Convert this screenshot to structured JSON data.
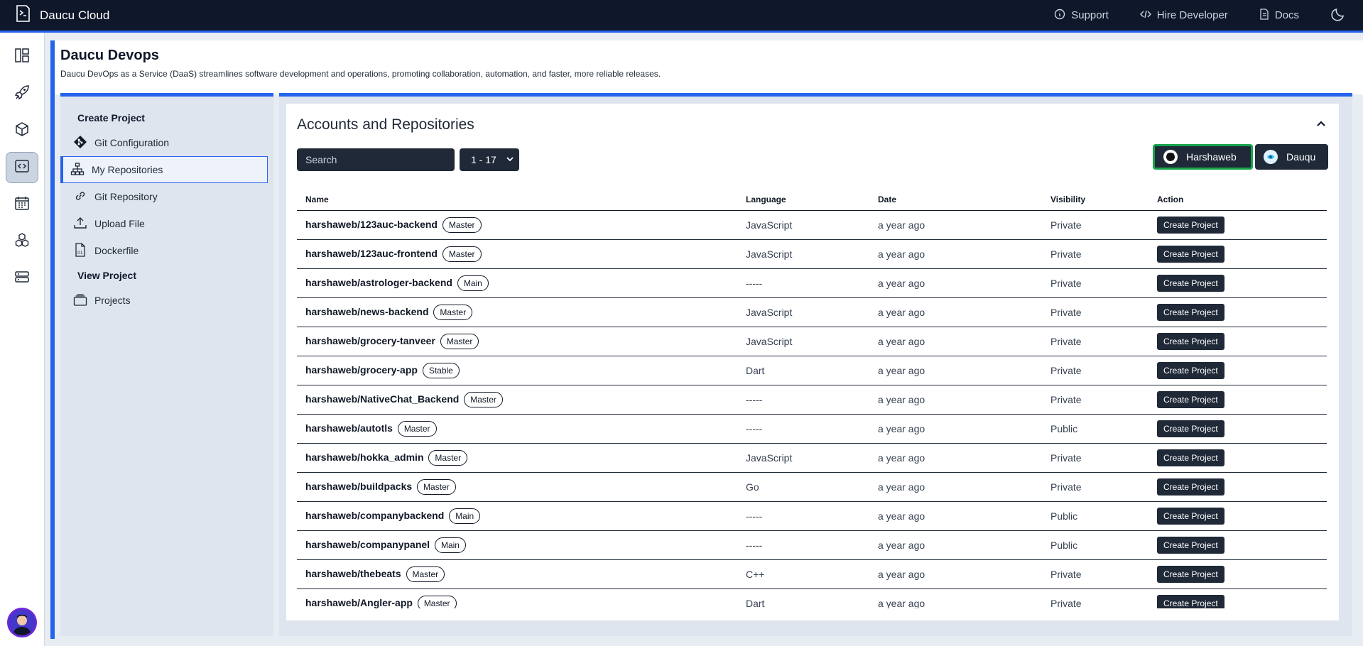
{
  "topbar": {
    "brand": "Daucu Cloud",
    "support": "Support",
    "hire": "Hire Developer",
    "docs": "Docs"
  },
  "header": {
    "title": "Daucu Devops",
    "subtitle": "Daucu DevOps as a Service (DaaS) streamlines software development and operations, promoting collaboration, automation, and faster, more reliable releases."
  },
  "menu": {
    "create_group": "Create Project",
    "git_config": "Git Configuration",
    "my_repos": "My Repositories",
    "git_repo": "Git Repository",
    "upload": "Upload File",
    "dockerfile": "Dockerfile",
    "view_group": "View Project",
    "projects": "Projects"
  },
  "main": {
    "title": "Accounts and Repositories",
    "search_placeholder": "Search",
    "range": "1 - 17",
    "account1": "Harshaweb",
    "account2": "Dauqu"
  },
  "table": {
    "headers": [
      "Name",
      "Language",
      "Date",
      "Visibility",
      "Action"
    ],
    "action_label": "Create Project",
    "rows": [
      {
        "name": "harshaweb/123auc-backend",
        "branch": "Master",
        "language": "JavaScript",
        "date": "a year ago",
        "visibility": "Private"
      },
      {
        "name": "harshaweb/123auc-frontend",
        "branch": "Master",
        "language": "JavaScript",
        "date": "a year ago",
        "visibility": "Private"
      },
      {
        "name": "harshaweb/astrologer-backend",
        "branch": "Main",
        "language": "-----",
        "date": "a year ago",
        "visibility": "Private"
      },
      {
        "name": "harshaweb/news-backend",
        "branch": "Master",
        "language": "JavaScript",
        "date": "a year ago",
        "visibility": "Private"
      },
      {
        "name": "harshaweb/grocery-tanveer",
        "branch": "Master",
        "language": "JavaScript",
        "date": "a year ago",
        "visibility": "Private"
      },
      {
        "name": "harshaweb/grocery-app",
        "branch": "Stable",
        "language": "Dart",
        "date": "a year ago",
        "visibility": "Private"
      },
      {
        "name": "harshaweb/NativeChat_Backend",
        "branch": "Master",
        "language": "-----",
        "date": "a year ago",
        "visibility": "Private"
      },
      {
        "name": "harshaweb/autotls",
        "branch": "Master",
        "language": "-----",
        "date": "a year ago",
        "visibility": "Public"
      },
      {
        "name": "harshaweb/hokka_admin",
        "branch": "Master",
        "language": "JavaScript",
        "date": "a year ago",
        "visibility": "Private"
      },
      {
        "name": "harshaweb/buildpacks",
        "branch": "Master",
        "language": "Go",
        "date": "a year ago",
        "visibility": "Private"
      },
      {
        "name": "harshaweb/companybackend",
        "branch": "Main",
        "language": "-----",
        "date": "a year ago",
        "visibility": "Public"
      },
      {
        "name": "harshaweb/companypanel",
        "branch": "Main",
        "language": "-----",
        "date": "a year ago",
        "visibility": "Public"
      },
      {
        "name": "harshaweb/thebeats",
        "branch": "Master",
        "language": "C++",
        "date": "a year ago",
        "visibility": "Private"
      },
      {
        "name": "harshaweb/Angler-app",
        "branch": "Master",
        "language": "Dart",
        "date": "a year ago",
        "visibility": "Private"
      }
    ]
  },
  "colors": {
    "accent": "#2563eb",
    "topbar": "#0f172a",
    "active_account_border": "#16a34a"
  }
}
